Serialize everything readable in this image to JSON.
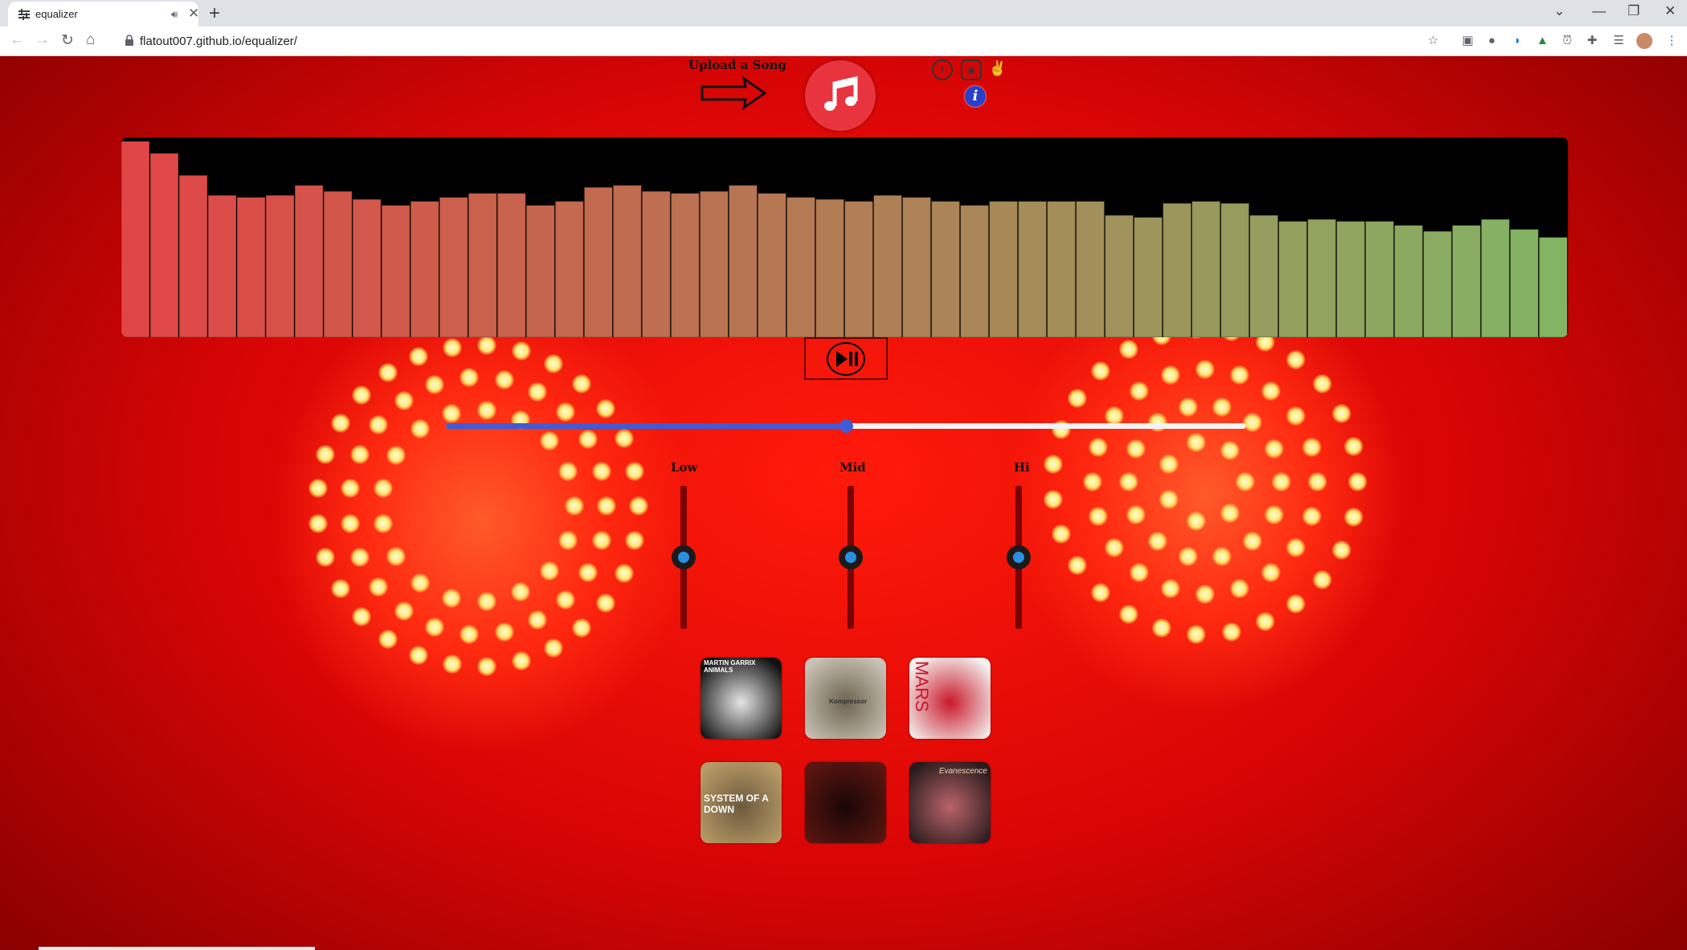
{
  "browser": {
    "tab_title": "equalizer",
    "audio_icon": "speaker-icon",
    "close_glyph": "✕",
    "new_tab_glyph": "+",
    "url": "flatout007.github.io/equalizer/"
  },
  "header": {
    "upload_label": "Upload a Song",
    "music_icon": "music-note-icon",
    "social_icons": [
      "fb-icon",
      "github-icon",
      "peace-icon"
    ],
    "info_glyph": "i"
  },
  "visualizer": {
    "levels": [
      0.98,
      0.92,
      0.81,
      0.71,
      0.7,
      0.71,
      0.76,
      0.73,
      0.69,
      0.66,
      0.68,
      0.7,
      0.72,
      0.72,
      0.66,
      0.68,
      0.75,
      0.76,
      0.73,
      0.72,
      0.73,
      0.76,
      0.72,
      0.7,
      0.69,
      0.68,
      0.71,
      0.7,
      0.68,
      0.66,
      0.68,
      0.68,
      0.68,
      0.68,
      0.61,
      0.6,
      0.67,
      0.68,
      0.67,
      0.61,
      0.58,
      0.59,
      0.58,
      0.58,
      0.56,
      0.53,
      0.56,
      0.59,
      0.54,
      0.5
    ]
  },
  "player": {
    "play_pause_glyph": "▶❚❚",
    "progress": 0.5
  },
  "equalizer": {
    "bands": [
      {
        "label": "Low",
        "level": 0.5
      },
      {
        "label": "Mid",
        "level": 0.5
      },
      {
        "label": "Hi",
        "level": 0.5
      }
    ]
  },
  "albums": [
    {
      "caption": "MARTIN GARRIX ANIMALS",
      "colors": [
        "#111111",
        "#e6e6e6"
      ]
    },
    {
      "caption": "Kompressor",
      "colors": [
        "#c8c2b4",
        "#6e6450"
      ]
    },
    {
      "caption": "MARS",
      "colors": [
        "#f4f0ee",
        "#c9182a"
      ]
    },
    {
      "caption": "SYSTEM OF A DOWN",
      "colors": [
        "#b89a66",
        "#6c5a3e"
      ]
    },
    {
      "caption": "",
      "colors": [
        "#5a1510",
        "#1a0606"
      ]
    },
    {
      "caption": "Evanescence",
      "colors": [
        "#2a1a1c",
        "#b8646a"
      ]
    }
  ]
}
